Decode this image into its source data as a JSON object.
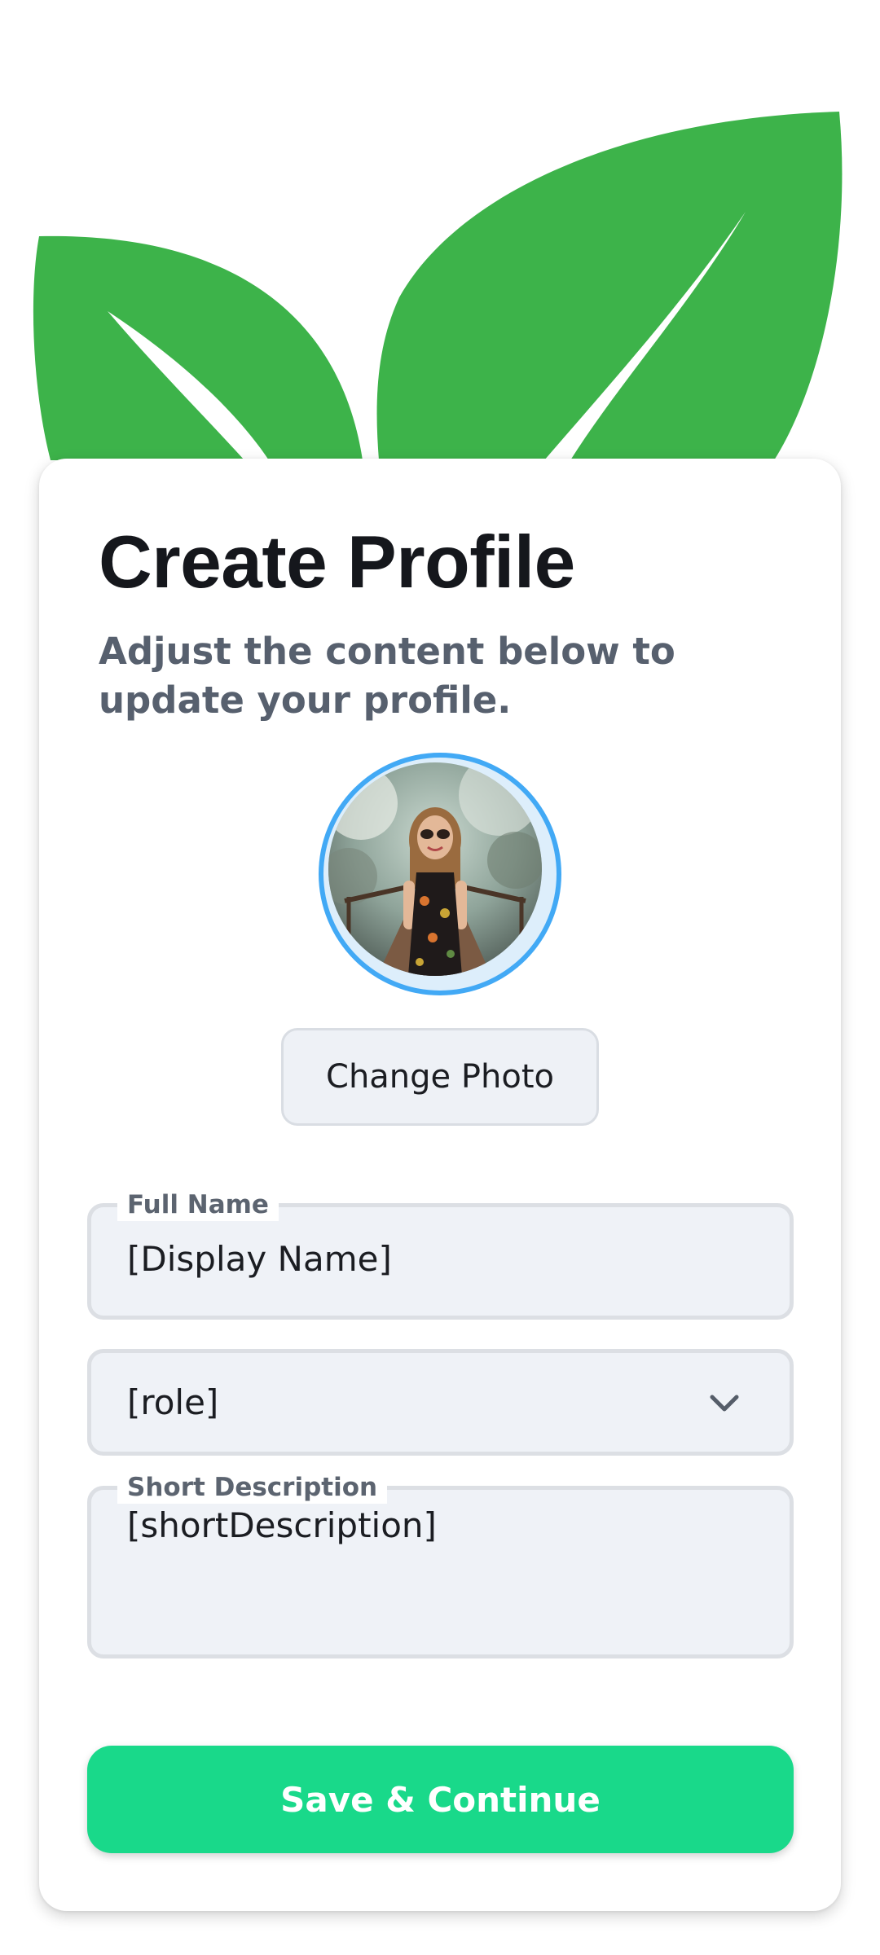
{
  "header": {
    "title": "Create Profile",
    "subtitle": "Adjust the content below to update your profile."
  },
  "avatar": {
    "icon": "profile-photo",
    "ring_color": "#42a9f5"
  },
  "buttons": {
    "change_photo": "Change Photo",
    "save": "Save & Continue",
    "save_color": "#19d98a"
  },
  "form": {
    "full_name": {
      "label": "Full Name",
      "value": "[Display Name]"
    },
    "role": {
      "value": "[role]",
      "icon": "chevron-down-icon"
    },
    "short_description": {
      "label": "Short Description",
      "value": "[shortDescription]"
    }
  },
  "decoration": {
    "icon": "leaf-icon",
    "leaf_color": "#3db34a"
  }
}
